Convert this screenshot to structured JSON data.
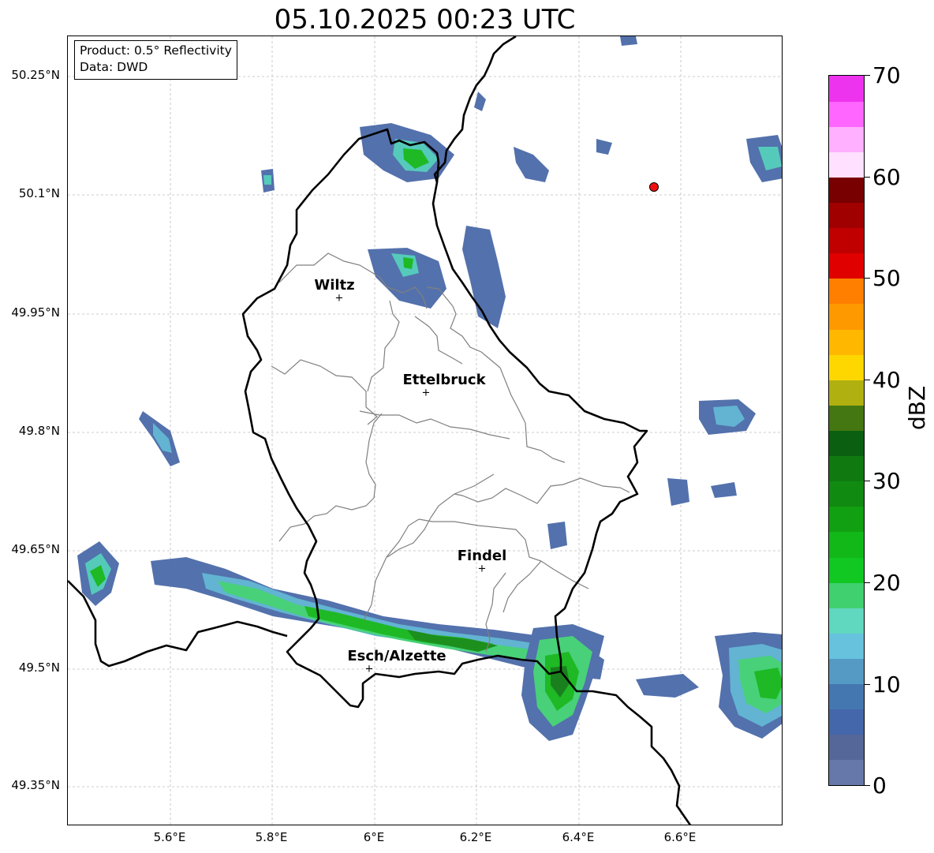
{
  "title": "05.10.2025 00:23 UTC",
  "info": {
    "product": "Product: 0.5° Reflectivity",
    "data_source": "Data: DWD"
  },
  "axes": {
    "lat_labels": [
      "50.25°N",
      "50.1°N",
      "49.95°N",
      "49.8°N",
      "49.65°N",
      "49.5°N",
      "49.35°N"
    ],
    "lon_labels": [
      "5.6°E",
      "5.8°E",
      "6°E",
      "6.2°E",
      "6.4°E",
      "6.6°E"
    ],
    "lat_range": [
      49.3,
      50.3
    ],
    "lon_range": [
      5.4,
      6.8
    ],
    "grid": true
  },
  "cities": [
    {
      "name": "Wiltz",
      "lat": 49.966,
      "lon": 5.932
    },
    {
      "name": "Ettelbruck",
      "lat": 49.847,
      "lon": 6.104
    },
    {
      "name": "Findel",
      "lat": 49.626,
      "lon": 6.211
    },
    {
      "name": "Esch/Alzette",
      "lat": 49.496,
      "lon": 5.988
    }
  ],
  "radar_site": {
    "lat": 50.11,
    "lon": 6.548,
    "color": "#ee1111"
  },
  "colorbar": {
    "label": "dBZ",
    "min": 0,
    "max": 70,
    "ticks": [
      "0",
      "10",
      "20",
      "30",
      "40",
      "50",
      "60",
      "70"
    ],
    "step": 2.5,
    "colors": [
      "#6677aa",
      "#556699",
      "#4466aa",
      "#4477b0",
      "#5599c5",
      "#66c2dd",
      "#60d8c0",
      "#40d070",
      "#11c822",
      "#11b818",
      "#11a011",
      "#118a11",
      "#107a10",
      "#0a6010",
      "#447711",
      "#b0b011",
      "#ffd700",
      "#ffb700",
      "#ff9900",
      "#ff7f00",
      "#e00000",
      "#c00000",
      "#a00000",
      "#780000",
      "#ffe0ff",
      "#ffb0ff",
      "#ff66ff",
      "#ee33ee"
    ]
  }
}
